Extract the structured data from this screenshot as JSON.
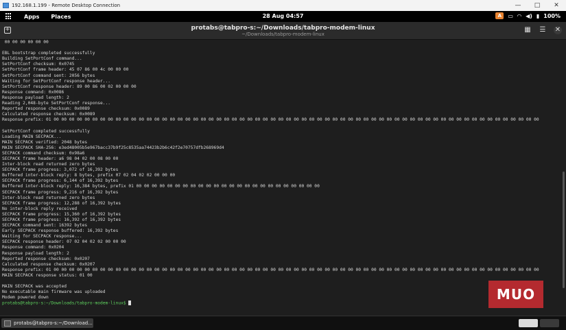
{
  "rdp": {
    "title": "192.168.1.199 - Remote Desktop Connection",
    "controls": [
      "—",
      "□",
      "✕"
    ]
  },
  "topbar": {
    "apps": "Apps",
    "places": "Places",
    "clock": "28 Aug  04:57",
    "badge": "A",
    "battery": "100%"
  },
  "terminal_header": {
    "title": "protabs@tabpro-s:~/Downloads/tabpro-modem-linux",
    "subtitle": "~/Downloads/tabpro-modem-linux"
  },
  "terminal": {
    "lines": [
      " 00 00 00 00 00 00",
      "",
      "EBL bootstrap completed successfully",
      "Building SetPortConf command...",
      "SetPortConf checksum: 0x0745",
      "SetPortConf frame header: 45 07 86 00 4c 00 00 00",
      "SetPortConf command sent: 2056 bytes",
      "Waiting for SetPortConf response header...",
      "SetPortConf response header: 89 00 86 00 02 00 00 00",
      "Response command: 0x0086",
      "Response payload length: 2",
      "Reading 2,048-byte SetPortConf response...",
      "Reported response checksum: 0x0089",
      "Calculated response checksum: 0x0089",
      "Response prefix: 01 00 00 00 00 00 00 00 00 00 00 00 00 00 00 00 00 00 00 00 00 00 00 00 00 00 00 00 00 00 00 00 00 00 00 00 00 00 00 00 00 00 00 00 00 00 00 00 00 00 00 00 00 00 00 00 00 00 00 00 00 00 00 00",
      "",
      "SetPortConf completed successfully",
      "Loading MAIN SECPACK...",
      "MAIN SECPACK verified: 2048 bytes",
      "MAIN SECPACK SHA-256: e3ed48005b5e967bacc37b9f25c8535aa74423b2b6c42f2e70757dfb268969d4",
      "SECPACK command checksum: 0x98a6",
      "SECPACK frame header: a6 98 04 02 00 08 00 00",
      "Inter-block read returned zero bytes",
      "SECPACK frame progress: 3,072 of 16,392 bytes",
      "Buffered inter-block reply: 8 bytes, prefix 07 02 04 02 02 00 00 00",
      "SECPACK frame progress: 6,144 of 16,392 bytes",
      "Buffered inter-block reply: 16,384 bytes, prefix 01 00 00 00 00 00 00 00 00 00 00 00 00 00 00 00 00 00 00 00 00 00 00 00 00",
      "SECPACK frame progress: 9,216 of 16,392 bytes",
      "Inter-block read returned zero bytes",
      "SECPACK frame progress: 12,288 of 16,392 bytes",
      "No inter-block reply received",
      "SECPACK frame progress: 15,360 of 16,392 bytes",
      "SECPACK frame progress: 16,392 of 16,392 bytes",
      "SECPACK command sent: 16392 bytes",
      "Early SECPACK response buffered: 16,392 bytes",
      "Waiting for SECPACK response...",
      "SECPACK response header: 07 02 04 02 02 00 00 00",
      "Response command: 0x0204",
      "Response payload length: 2",
      "Reported response checksum: 0x0207",
      "Calculated response checksum: 0x0207",
      "Response prefix: 01 00 00 00 00 00 00 00 00 00 00 00 00 00 00 00 00 00 00 00 00 00 00 00 00 00 00 00 00 00 00 00 00 00 00 00 00 00 00 00 00 00 00 00 00 00 00 00 00 00 00 00 00 00 00 00 00 00 00 00 00 00 00 00",
      "MAIN SECPACK response status: 01 00",
      "",
      "MAIN SECPACK was accepted",
      "No executable main firmware was uploaded",
      "Modem powered down"
    ],
    "prompt": "protabs@tabpro-s:~/Downloads/tabpro-modem-linux$"
  },
  "watermark": "MUO",
  "taskbar": {
    "item_label": "protabs@tabpro-s:~/Download..."
  }
}
